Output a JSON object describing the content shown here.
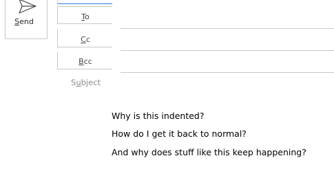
{
  "send": {
    "label_prefix": "",
    "label_underlined": "S",
    "label_rest": "end",
    "icon": "send-icon"
  },
  "fields": {
    "to": {
      "underlined": "T",
      "rest": "o",
      "value": ""
    },
    "cc": {
      "underlined": "C",
      "rest": "c",
      "value": ""
    },
    "bcc": {
      "underlined": "B",
      "rest": "cc",
      "value": ""
    },
    "subject": {
      "prefix": "S",
      "underlined": "u",
      "rest": "bject",
      "value": ""
    }
  },
  "message_body": {
    "lines": [
      "Why is this indented?",
      "How do I get it back to normal?",
      "And why does stuff like this keep happening?"
    ]
  },
  "colors": {
    "accent": "#2b78d7",
    "border": "#c8c8c8",
    "muted_text": "#8a8a8a"
  }
}
